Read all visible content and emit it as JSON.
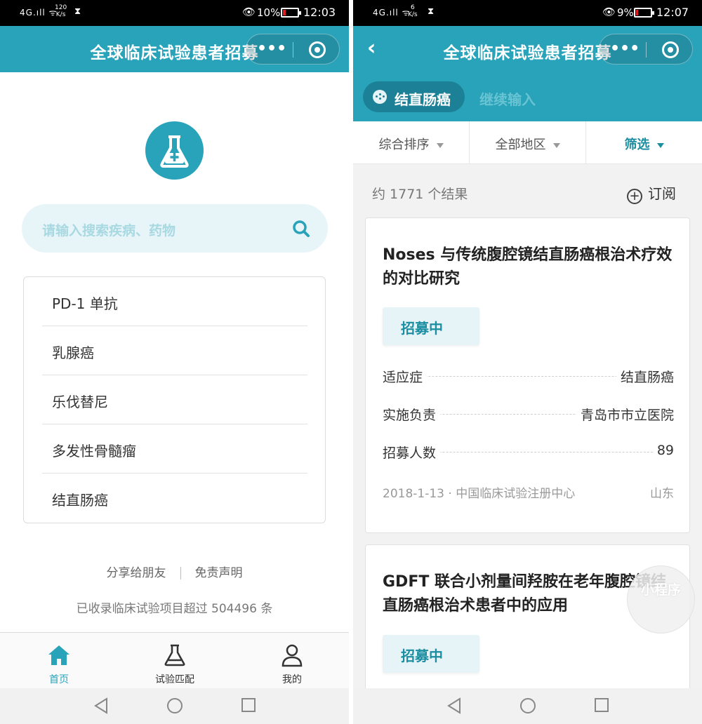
{
  "left": {
    "status": {
      "network": "4G",
      "speed_value": "120",
      "speed_unit": "K/s",
      "battery": "10%",
      "battery_level": 0.1,
      "time": "12:03"
    },
    "nav": {
      "title": "全球临床试验患者招募"
    },
    "search": {
      "placeholder": "请输入搜索疾病、药物"
    },
    "hot_items": [
      {
        "label": "PD-1 单抗"
      },
      {
        "label": "乳腺癌"
      },
      {
        "label": "乐伐替尼"
      },
      {
        "label": "多发性骨髓瘤"
      },
      {
        "label": "结直肠癌"
      }
    ],
    "links": {
      "share": "分享给朋友",
      "disclaimer": "免责声明"
    },
    "count_note": "已收录临床试验项目超过 504496 条",
    "tabs": [
      {
        "label": "首页",
        "icon": "home-icon",
        "active": true
      },
      {
        "label": "试验匹配",
        "icon": "flask-icon",
        "active": false
      },
      {
        "label": "我的",
        "icon": "person-icon",
        "active": false
      }
    ]
  },
  "right": {
    "status": {
      "network": "4G",
      "speed_value": "6",
      "speed_unit": "K/s",
      "battery": "9%",
      "battery_level": 0.09,
      "time": "12:07"
    },
    "nav": {
      "title": "全球临床试验患者招募"
    },
    "query": {
      "term": "结直肠癌",
      "continue_label": "继续输入"
    },
    "filters": {
      "sort": "综合排序",
      "region": "全部地区",
      "filter": "筛选"
    },
    "results": {
      "count_text": "约 1771 个结果",
      "subscribe_label": "订阅"
    },
    "cards": [
      {
        "title": "Noses 与传统腹腔镜结直肠癌根治术疗效的对比研究",
        "status": "招募中",
        "indication_label": "适应症",
        "indication": "结直肠癌",
        "lead_label": "实施负责",
        "lead": "青岛市市立医院",
        "enroll_label": "招募人数",
        "enroll": "89",
        "date_source": "2018-1-13 · 中国临床试验注册中心",
        "location": "山东"
      },
      {
        "title": "GDFT 联合小剂量间羟胺在老年腹腔镜结直肠癌根治术患者中的应用",
        "status": "招募中"
      }
    ],
    "float_stamp": "小程序"
  },
  "colors": {
    "primary": "#29a3b9",
    "primary_dark": "#1c8196",
    "accent_text": "#1c8ea2",
    "status_bar": "#000000"
  }
}
